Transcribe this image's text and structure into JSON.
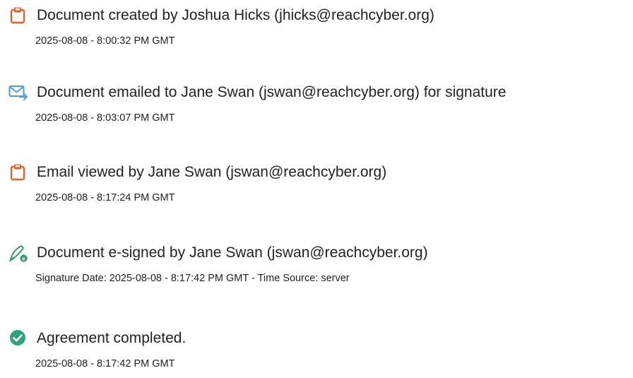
{
  "events": [
    {
      "icon": "document-created-icon",
      "title": "Document created by Joshua Hicks (jhicks@reachcyber.org)",
      "meta": "2025-08-08 - 8:00:32 PM GMT"
    },
    {
      "icon": "email-sent-icon",
      "title": "Document emailed to Jane Swan (jswan@reachcyber.org) for signature",
      "meta": "2025-08-08 - 8:03:07 PM GMT"
    },
    {
      "icon": "document-viewed-icon",
      "title": "Email viewed by Jane Swan (jswan@reachcyber.org)",
      "meta": "2025-08-08 - 8:17:24 PM GMT"
    },
    {
      "icon": "esign-pen-icon",
      "title": "Document e-signed by Jane Swan (jswan@reachcyber.org)",
      "meta": "Signature Date: 2025-08-08 - 8:17:42 PM GMT - Time Source: server"
    },
    {
      "icon": "checkmark-circle-icon",
      "title": "Agreement completed.",
      "meta": "2025-08-08 - 8:17:42 PM GMT"
    }
  ],
  "colors": {
    "doc_icon": "#e8602c",
    "email_icon": "#4a9fd6",
    "pen_icon": "#3a9e6e",
    "check_icon": "#2fa37a"
  }
}
